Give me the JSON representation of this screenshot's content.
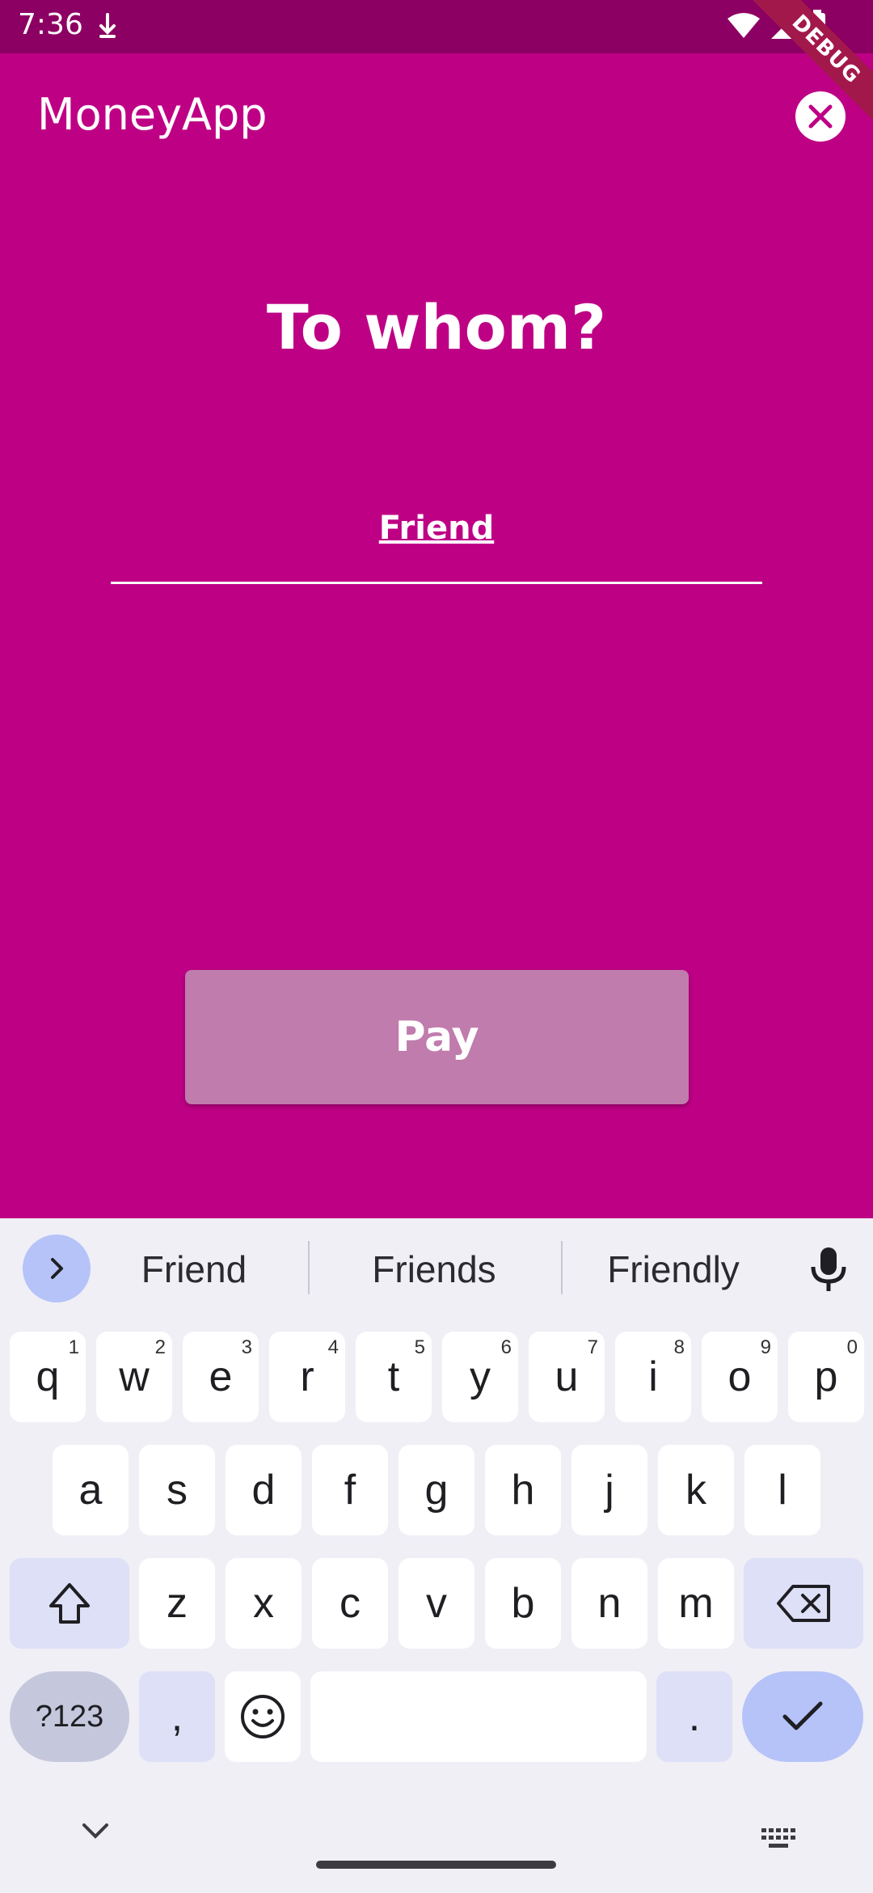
{
  "status_bar": {
    "time": "7:36"
  },
  "debug_banner": "DEBUG",
  "app_bar": {
    "title": "MoneyApp"
  },
  "heading": "To whom?",
  "recipient_field": {
    "value": "Friend"
  },
  "pay_button": {
    "label": "Pay"
  },
  "keyboard": {
    "suggestions": [
      "Friend",
      "Friends",
      "Friendly"
    ],
    "row1": [
      {
        "k": "q",
        "h": "1"
      },
      {
        "k": "w",
        "h": "2"
      },
      {
        "k": "e",
        "h": "3"
      },
      {
        "k": "r",
        "h": "4"
      },
      {
        "k": "t",
        "h": "5"
      },
      {
        "k": "y",
        "h": "6"
      },
      {
        "k": "u",
        "h": "7"
      },
      {
        "k": "i",
        "h": "8"
      },
      {
        "k": "o",
        "h": "9"
      },
      {
        "k": "p",
        "h": "0"
      }
    ],
    "row2": [
      "a",
      "s",
      "d",
      "f",
      "g",
      "h",
      "j",
      "k",
      "l"
    ],
    "row3": [
      "z",
      "x",
      "c",
      "v",
      "b",
      "n",
      "m"
    ],
    "symbols_label": "?123",
    "comma_label": ",",
    "period_label": "."
  },
  "colors": {
    "background": "#be0085",
    "status_bar": "#8d0063",
    "pay_button": "#c07cac",
    "keyboard": "#f0eff6"
  }
}
